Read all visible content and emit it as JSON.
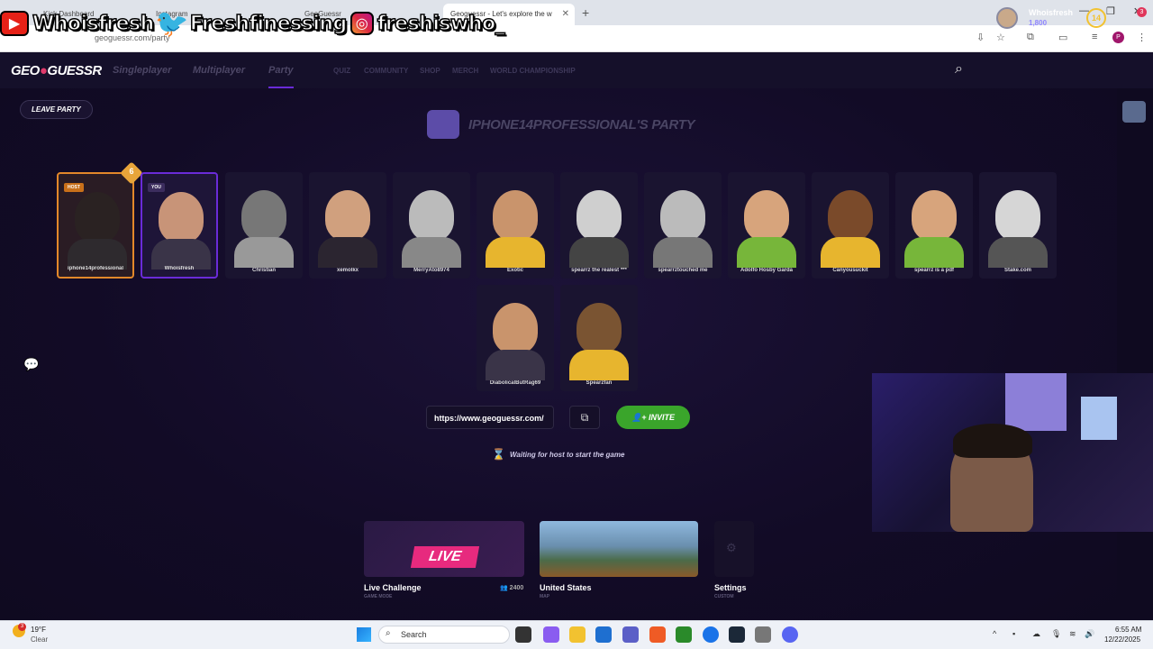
{
  "browser": {
    "tabs": [
      {
        "label": "Kick Dashboard"
      },
      {
        "label": "Instagram"
      },
      {
        "label": "GeoGuessr"
      },
      {
        "label": "Geoguessr - Let's explore the w"
      }
    ],
    "url": "geoguessr.com/party"
  },
  "overlay": {
    "youtube": "Whoisfresh",
    "twitter": "Freshfinessing",
    "instagram": "freshiswho_"
  },
  "nav": {
    "logo_a": "GEO",
    "logo_b": "GUESSR",
    "links": [
      "Singleplayer",
      "Multiplayer",
      "Party"
    ],
    "small_links": [
      "QUIZ",
      "COMMUNITY",
      "SHOP",
      "MERCH",
      "WORLD CHAMPIONSHIP"
    ],
    "user_name": "Whoisfresh",
    "user_coins": "1,800",
    "user_level": "14",
    "notifications": "3"
  },
  "party": {
    "leave_label": "LEAVE PARTY",
    "title": "IPHONE14PROFESSIONAL'S PARTY",
    "host_level": "6",
    "members": [
      {
        "name": "iphone14professional",
        "badge": "HOST"
      },
      {
        "name": "Whoisfresh",
        "badge": "YOU"
      },
      {
        "name": "Christian",
        "badge": ""
      },
      {
        "name": "xemolkx",
        "badge": ""
      },
      {
        "name": "MerryAto8974",
        "badge": ""
      },
      {
        "name": "Exotic",
        "badge": ""
      },
      {
        "name": "spearrz the realest ***",
        "badge": ""
      },
      {
        "name": "spearrztouched me",
        "badge": ""
      },
      {
        "name": "Adolfo Hosby Garda",
        "badge": ""
      },
      {
        "name": "Canyousuckit",
        "badge": ""
      },
      {
        "name": "spearrz is a pdf",
        "badge": ""
      },
      {
        "name": "Stake.com",
        "badge": ""
      },
      {
        "name": "DiabolicalButRag69",
        "badge": ""
      },
      {
        "name": "Spearzfan",
        "badge": ""
      }
    ],
    "invite_url": "https://www.geoguessr.com/",
    "invite_label": "INVITE",
    "waiting": "Waiting for host to start the game"
  },
  "modes": {
    "live_badge": "LIVE",
    "live_title": "Live Challenge",
    "live_sub": "GAME MODE",
    "live_count": "2400",
    "map_title": "United States",
    "map_sub": "MAP",
    "settings_title": "Settings",
    "settings_sub": "CUSTOM"
  },
  "taskbar": {
    "temp": "19°F",
    "weather": "Clear",
    "weather_badge": "3",
    "search": "Search",
    "time": "6:55 AM",
    "date": "12/22/2025"
  },
  "colors": {
    "accent": "#6a2bd8",
    "host": "#e3882a",
    "invite": "#3aa52b",
    "live": "#e72a7e"
  }
}
